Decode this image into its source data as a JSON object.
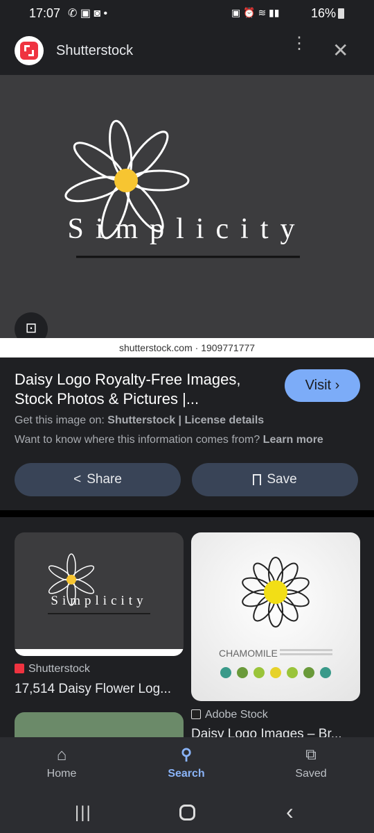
{
  "status_bar": {
    "time": "17:07",
    "battery": "16%"
  },
  "header": {
    "title": "Shutterstock"
  },
  "hero": {
    "logo_text": "Simplicity",
    "watermark": "shutterstock.com · 1909771777"
  },
  "result": {
    "title": "Daisy Logo Royalty-Free Images, Stock Photos & Pictures |...",
    "visit_label": "Visit",
    "source_prefix": "Get this image on:",
    "source_name": "Shutterstock",
    "separator": "|",
    "license": "License details",
    "info_question": "Want to know where this information comes from?",
    "learn_more": "Learn more",
    "share_label": "Share",
    "save_label": "Save"
  },
  "grid": [
    {
      "source": "Shutterstock",
      "title": "17,514 Daisy Flower Log...",
      "thumb_text": "Simplicity"
    },
    {
      "source": "Adobe Stock",
      "title": "Daisy Logo Images – Br...",
      "thumb_text": "CHAMOMILE"
    }
  ],
  "bottom_nav": [
    {
      "label": "Home"
    },
    {
      "label": "Search",
      "active": true
    },
    {
      "label": "Saved"
    }
  ],
  "colors": {
    "accent": "#8ab4f8",
    "visit_bg": "#7cacf8",
    "pill_bg": "#394457",
    "brand_red": "#ef3340"
  }
}
